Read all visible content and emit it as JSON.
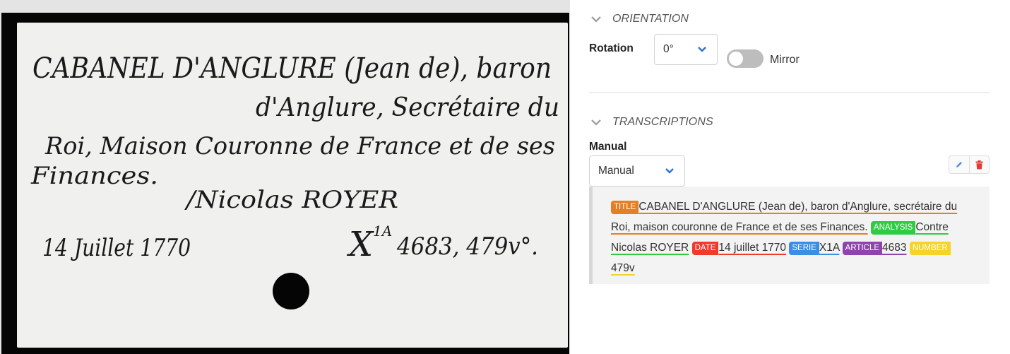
{
  "orientation": {
    "title": "ORIENTATION",
    "rotation_label": "Rotation",
    "rotation_value": "0°",
    "mirror_label": "Mirror",
    "mirror_on": false
  },
  "transcriptions": {
    "title": "TRANSCRIPTIONS",
    "type_label": "Manual",
    "type_value": "Manual",
    "entities": [
      {
        "tag": "TITLE",
        "color": "#e67e22",
        "text": "CABANEL D'ANGLURE (Jean de), baron d'Anglure, secrétaire du Roi, maison couronne de France et de ses Finances."
      },
      {
        "tag": "ANALYSIS",
        "color": "#2ecc40",
        "text": "Contre Nicolas ROYER"
      },
      {
        "tag": "DATE",
        "color": "#f03a2e",
        "text": "14 juillet 1770"
      },
      {
        "tag": "SERIE",
        "color": "#3a8ee6",
        "text": "X1A"
      },
      {
        "tag": "ARTICLE",
        "color": "#8e44ad",
        "text": "4683"
      },
      {
        "tag": "NUMBER",
        "color": "#f5d327",
        "text": "479v"
      }
    ]
  },
  "card_text": {
    "line1": "CABANEL D'ANGLURE (Jean de), baron",
    "line2": "d'Anglure, Secrétaire du",
    "line3": "Roi, Maison Couronne de France et de ses",
    "line4": "Finances.",
    "line5": "/Nicolas ROYER",
    "date": "14 Juillet 1770",
    "ref": "X",
    "ref_sup": "1A",
    "ref_num": "4683, 479v°."
  },
  "colors": {
    "accent": "#2b72d6",
    "delete": "#e53935"
  }
}
